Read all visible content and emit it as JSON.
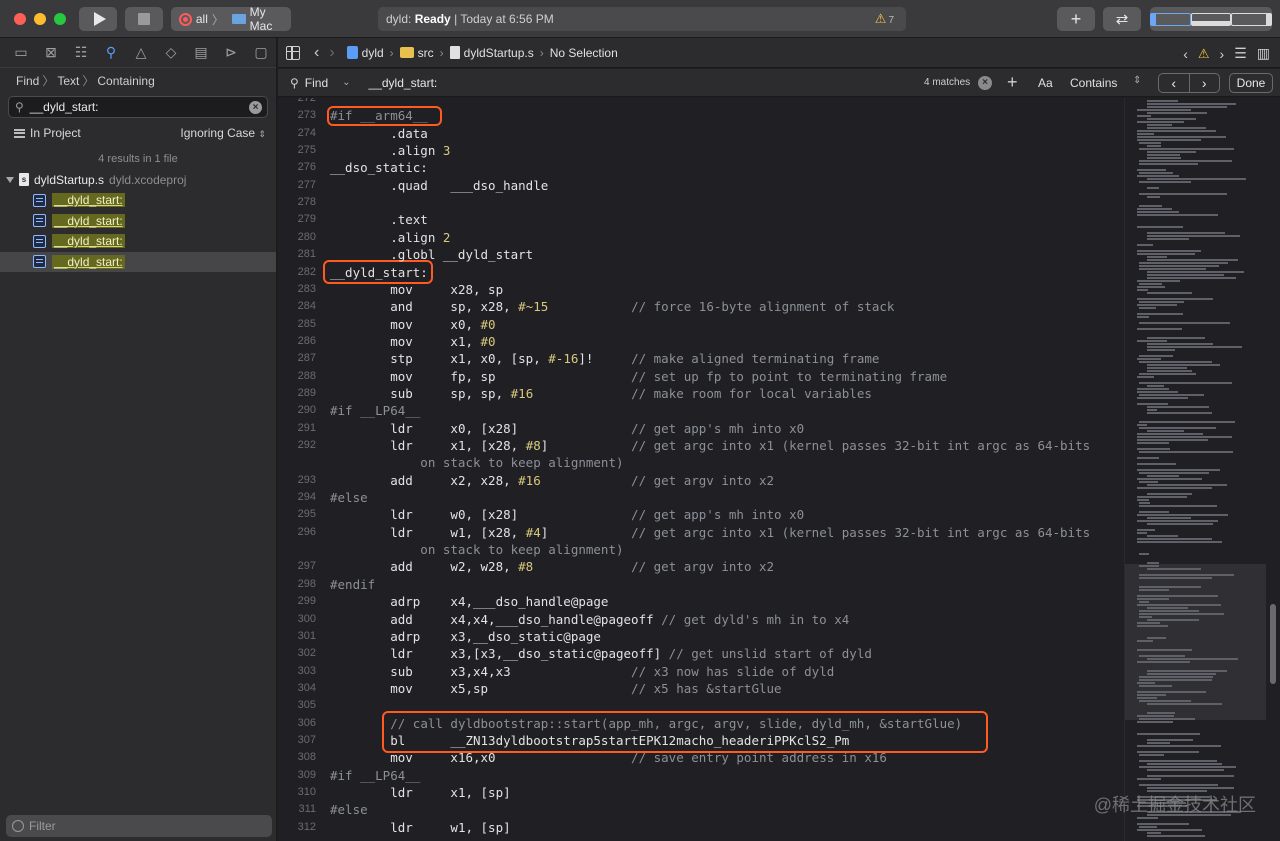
{
  "toolbar": {
    "scheme": "all",
    "destination": "My Mac",
    "status_prefix": "dyld:",
    "status_state": "Ready",
    "status_time": "| Today at 6:56 PM",
    "warning_count": "7"
  },
  "navigator": {
    "path": [
      "Find",
      "Text",
      "Containing"
    ],
    "search_value": "__dyld_start:",
    "scope": "In Project",
    "case_option": "Ignoring Case",
    "results_summary": "4 results in 1 file",
    "file": {
      "name": "dyldStartup.s",
      "project": "dyld.xcodeproj"
    },
    "matches": [
      "__dyld_start:",
      "__dyld_start:",
      "__dyld_start:",
      "__dyld_start:"
    ],
    "filter_placeholder": "Filter"
  },
  "jumpbar": {
    "crumbs": [
      "dyld",
      "src",
      "dyldStartup.s",
      "No Selection"
    ]
  },
  "findbar": {
    "mode": "Find",
    "query": "__dyld_start:",
    "match_count": "4 matches",
    "case_label": "Aa",
    "match_type": "Contains",
    "done_label": "Done"
  },
  "code": [
    {
      "n": "272",
      "t": ""
    },
    {
      "n": "273",
      "t": "#if __arm64__",
      "k": "pp"
    },
    {
      "n": "274",
      "t": "        .data"
    },
    {
      "n": "275",
      "t": "        .align 3",
      "nums": true
    },
    {
      "n": "276",
      "t": "__dso_static:"
    },
    {
      "n": "277",
      "t": "        .quad   ___dso_handle"
    },
    {
      "n": "278",
      "t": ""
    },
    {
      "n": "279",
      "t": "        .text"
    },
    {
      "n": "280",
      "t": "        .align 2"
    },
    {
      "n": "281",
      "t": "        .globl __dyld_start"
    },
    {
      "n": "282",
      "t": "__dyld_start:"
    },
    {
      "n": "283",
      "t": "        mov     x28, sp"
    },
    {
      "n": "284",
      "t": "        and     sp, x28, #~15           ",
      "c": "// force 16-byte alignment of stack"
    },
    {
      "n": "285",
      "t": "        mov     x0, #0"
    },
    {
      "n": "286",
      "t": "        mov     x1, #0"
    },
    {
      "n": "287",
      "t": "        stp     x1, x0, [sp, #-16]!     ",
      "c": "// make aligned terminating frame"
    },
    {
      "n": "288",
      "t": "        mov     fp, sp                  ",
      "c": "// set up fp to point to terminating frame"
    },
    {
      "n": "289",
      "t": "        sub     sp, sp, #16             ",
      "c": "// make room for local variables"
    },
    {
      "n": "290",
      "t": "#if __LP64__",
      "k": "pp"
    },
    {
      "n": "291",
      "t": "        ldr     x0, [x28]               ",
      "c": "// get app's mh into x0"
    },
    {
      "n": "292",
      "t": "        ldr     x1, [x28, #8]           ",
      "c": "// get argc into x1 (kernel passes 32-bit int argc as 64-bits"
    },
    {
      "n": "",
      "t": "",
      "c": "            on stack to keep alignment)"
    },
    {
      "n": "293",
      "t": "        add     x2, x28, #16            ",
      "c": "// get argv into x2"
    },
    {
      "n": "294",
      "t": "#else",
      "k": "pp"
    },
    {
      "n": "295",
      "t": "        ldr     w0, [x28]               ",
      "c": "// get app's mh into x0"
    },
    {
      "n": "296",
      "t": "        ldr     w1, [x28, #4]           ",
      "c": "// get argc into x1 (kernel passes 32-bit int argc as 64-bits"
    },
    {
      "n": "",
      "t": "",
      "c": "            on stack to keep alignment)"
    },
    {
      "n": "297",
      "t": "        add     w2, w28, #8             ",
      "c": "// get argv into x2"
    },
    {
      "n": "298",
      "t": "#endif",
      "k": "pp"
    },
    {
      "n": "299",
      "t": "        adrp    x4,___dso_handle@page"
    },
    {
      "n": "300",
      "t": "        add     x4,x4,___dso_handle@pageoff ",
      "c": "// get dyld's mh in to x4"
    },
    {
      "n": "301",
      "t": "        adrp    x3,__dso_static@page"
    },
    {
      "n": "302",
      "t": "        ldr     x3,[x3,__dso_static@pageoff] ",
      "c": "// get unslid start of dyld"
    },
    {
      "n": "303",
      "t": "        sub     x3,x4,x3                ",
      "c": "// x3 now has slide of dyld"
    },
    {
      "n": "304",
      "t": "        mov     x5,sp                   ",
      "c": "// x5 has &startGlue"
    },
    {
      "n": "305",
      "t": ""
    },
    {
      "n": "306",
      "t": "        ",
      "c": "// call dyldbootstrap::start(app_mh, argc, argv, slide, dyld_mh, &startGlue)"
    },
    {
      "n": "307",
      "t": "        bl      __ZN13dyldbootstrap5startEPK12macho_headeriPPKclS2_Pm"
    },
    {
      "n": "308",
      "t": "        mov     x16,x0                  ",
      "c": "// save entry point address in x16"
    },
    {
      "n": "309",
      "t": "#if __LP64__",
      "k": "pp"
    },
    {
      "n": "310",
      "t": "        ldr     x1, [sp]"
    },
    {
      "n": "311",
      "t": "#else",
      "k": "pp"
    },
    {
      "n": "312",
      "t": "        ldr     w1, [sp]"
    }
  ],
  "watermark": "@稀土掘金技术社区",
  "colors": {
    "accent": "#5b9cf5",
    "highlight_box": "#ff5a1f",
    "match_bg": "#65691f"
  }
}
